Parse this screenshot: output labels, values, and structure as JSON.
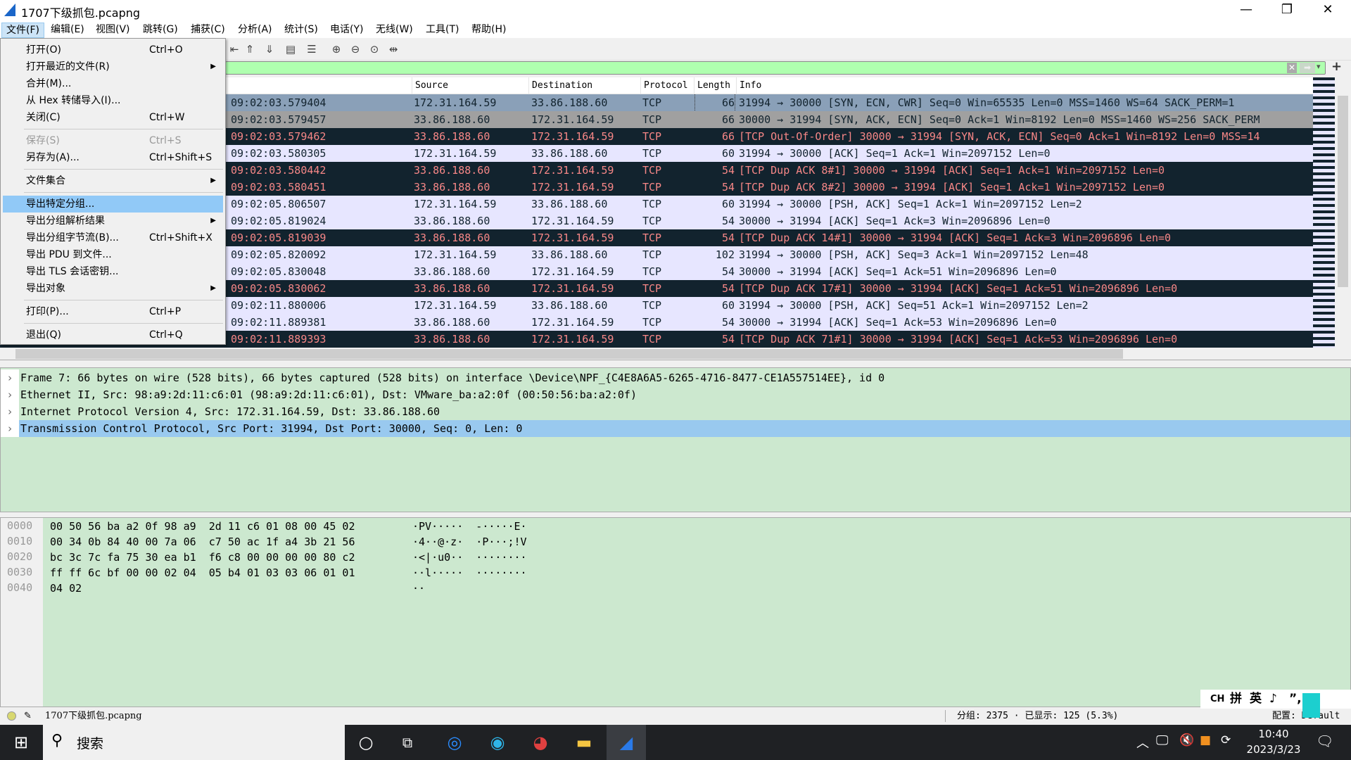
{
  "window": {
    "title": "1707下级抓包.pcapng",
    "minimize": "—",
    "restore": "❐",
    "close": "✕"
  },
  "menubar": [
    "文件(F)",
    "编辑(E)",
    "视图(V)",
    "跳转(G)",
    "捕获(C)",
    "分析(A)",
    "统计(S)",
    "电话(Y)",
    "无线(W)",
    "工具(T)",
    "帮助(H)"
  ],
  "file_menu": [
    {
      "label": "打开(O)",
      "shortcut": "Ctrl+O"
    },
    {
      "label": "打开最近的文件(R)",
      "submenu": true
    },
    {
      "label": "合并(M)..."
    },
    {
      "label": "从 Hex 转储导入(I)..."
    },
    {
      "label": "关闭(C)",
      "shortcut": "Ctrl+W"
    },
    {
      "sep": true
    },
    {
      "label": "保存(S)",
      "shortcut": "Ctrl+S",
      "disabled": true
    },
    {
      "label": "另存为(A)...",
      "shortcut": "Ctrl+Shift+S"
    },
    {
      "sep": true
    },
    {
      "label": "文件集合",
      "submenu": true
    },
    {
      "sep": true
    },
    {
      "label": "导出特定分组...",
      "highlighted": true
    },
    {
      "label": "导出分组解析结果",
      "submenu": true
    },
    {
      "label": "导出分组字节流(B)...",
      "shortcut": "Ctrl+Shift+X"
    },
    {
      "label": "导出 PDU 到文件..."
    },
    {
      "label": "导出 TLS 会话密钥..."
    },
    {
      "label": "导出对象",
      "submenu": true
    },
    {
      "sep": true
    },
    {
      "label": "打印(P)...",
      "shortcut": "Ctrl+P"
    },
    {
      "sep": true
    },
    {
      "label": "退出(Q)",
      "shortcut": "Ctrl+Q"
    }
  ],
  "toolbar_icons": [
    "go-first-icon",
    "go-top-icon",
    "go-bottom-icon",
    "autoscroll-icon",
    "colorize-icon",
    "zoom-in-icon",
    "zoom-out-icon",
    "zoom-normal-icon",
    "resize-columns-icon"
  ],
  "filter": {
    "value": "",
    "clear": "✕",
    "apply": "➡",
    "dropdown": "▾",
    "add": "+"
  },
  "columns": [
    "Source",
    "Destination",
    "Protocol",
    "Length",
    "Info"
  ],
  "packets": [
    {
      "time": "09:02:03.579404",
      "src": "172.31.164.59",
      "dst": "33.86.188.60",
      "proto": "TCP",
      "len": "66",
      "info": "31994 → 30000 [SYN, ECN, CWR] Seq=0 Win=65535 Len=0 MSS=1460 WS=64 SACK_PERM=1",
      "style": "sel"
    },
    {
      "time": "09:02:03.579457",
      "src": "33.86.188.60",
      "dst": "172.31.164.59",
      "proto": "TCP",
      "len": "66",
      "info": "30000 → 31994 [SYN, ACK, ECN] Seq=0 Ack=1 Win=8192 Len=0 MSS=1460 WS=256 SACK_PERM",
      "style": "gray"
    },
    {
      "time": "09:02:03.579462",
      "src": "33.86.188.60",
      "dst": "172.31.164.59",
      "proto": "TCP",
      "len": "66",
      "info": "[TCP Out-Of-Order] 30000 → 31994 [SYN, ACK, ECN] Seq=0 Ack=1 Win=8192 Len=0 MSS=14",
      "style": "dark"
    },
    {
      "time": "09:02:03.580305",
      "src": "172.31.164.59",
      "dst": "33.86.188.60",
      "proto": "TCP",
      "len": "60",
      "info": "31994 → 30000 [ACK] Seq=1 Ack=1 Win=2097152 Len=0",
      "style": "light"
    },
    {
      "time": "09:02:03.580442",
      "src": "33.86.188.60",
      "dst": "172.31.164.59",
      "proto": "TCP",
      "len": "54",
      "info": "[TCP Dup ACK 8#1] 30000 → 31994 [ACK] Seq=1 Ack=1 Win=2097152 Len=0",
      "style": "dark"
    },
    {
      "time": "09:02:03.580451",
      "src": "33.86.188.60",
      "dst": "172.31.164.59",
      "proto": "TCP",
      "len": "54",
      "info": "[TCP Dup ACK 8#2] 30000 → 31994 [ACK] Seq=1 Ack=1 Win=2097152 Len=0",
      "style": "dark"
    },
    {
      "time": "09:02:05.806507",
      "src": "172.31.164.59",
      "dst": "33.86.188.60",
      "proto": "TCP",
      "len": "60",
      "info": "31994 → 30000 [PSH, ACK] Seq=1 Ack=1 Win=2097152 Len=2",
      "style": "light"
    },
    {
      "time": "09:02:05.819024",
      "src": "33.86.188.60",
      "dst": "172.31.164.59",
      "proto": "TCP",
      "len": "54",
      "info": "30000 → 31994 [ACK] Seq=1 Ack=3 Win=2096896 Len=0",
      "style": "light"
    },
    {
      "time": "09:02:05.819039",
      "src": "33.86.188.60",
      "dst": "172.31.164.59",
      "proto": "TCP",
      "len": "54",
      "info": "[TCP Dup ACK 14#1] 30000 → 31994 [ACK] Seq=1 Ack=3 Win=2096896 Len=0",
      "style": "dark"
    },
    {
      "time": "09:02:05.820092",
      "src": "172.31.164.59",
      "dst": "33.86.188.60",
      "proto": "TCP",
      "len": "102",
      "info": "31994 → 30000 [PSH, ACK] Seq=3 Ack=1 Win=2097152 Len=48",
      "style": "light"
    },
    {
      "time": "09:02:05.830048",
      "src": "33.86.188.60",
      "dst": "172.31.164.59",
      "proto": "TCP",
      "len": "54",
      "info": "30000 → 31994 [ACK] Seq=1 Ack=51 Win=2096896 Len=0",
      "style": "light"
    },
    {
      "time": "09:02:05.830062",
      "src": "33.86.188.60",
      "dst": "172.31.164.59",
      "proto": "TCP",
      "len": "54",
      "info": "[TCP Dup ACK 17#1] 30000 → 31994 [ACK] Seq=1 Ack=51 Win=2096896 Len=0",
      "style": "dark"
    },
    {
      "time": "09:02:11.880006",
      "src": "172.31.164.59",
      "dst": "33.86.188.60",
      "proto": "TCP",
      "len": "60",
      "info": "31994 → 30000 [PSH, ACK] Seq=51 Ack=1 Win=2097152 Len=2",
      "style": "light"
    },
    {
      "time": "09:02:11.889381",
      "src": "33.86.188.60",
      "dst": "172.31.164.59",
      "proto": "TCP",
      "len": "54",
      "info": "30000 → 31994 [ACK] Seq=1 Ack=53 Win=2096896 Len=0",
      "style": "light"
    },
    {
      "time": "09:02:11.889393",
      "src": "33.86.188.60",
      "dst": "172.31.164.59",
      "proto": "TCP",
      "len": "54",
      "info": "[TCP Dup ACK 71#1] 30000 → 31994 [ACK] Seq=1 Ack=53 Win=2096896 Len=0",
      "style": "dark"
    }
  ],
  "details": [
    {
      "text": "Frame 7: 66 bytes on wire (528 bits), 66 bytes captured (528 bits) on interface \\Device\\NPF_{C4E8A6A5-6265-4716-8477-CE1A557514EE}, id 0"
    },
    {
      "text": "Ethernet II, Src: 98:a9:2d:11:c6:01 (98:a9:2d:11:c6:01), Dst: VMware_ba:a2:0f (00:50:56:ba:a2:0f)"
    },
    {
      "text": "Internet Protocol Version 4, Src: 172.31.164.59, Dst: 33.86.188.60"
    },
    {
      "text": "Transmission Control Protocol, Src Port: 31994, Dst Port: 30000, Seq: 0, Len: 0",
      "selected": true
    }
  ],
  "hex": [
    {
      "off": "0000",
      "bytes": "00 50 56 ba a2 0f 98 a9  2d 11 c6 01 08 00 45 02",
      "ascii": "·PV·····  -·····E·"
    },
    {
      "off": "0010",
      "bytes": "00 34 0b 84 40 00 7a 06  c7 50 ac 1f a4 3b 21 56",
      "ascii": "·4··@·z·  ·P···;!V"
    },
    {
      "off": "0020",
      "bytes": "bc 3c 7c fa 75 30 ea b1  f6 c8 00 00 00 00 80 c2",
      "ascii": "·<|·u0··  ········"
    },
    {
      "off": "0030",
      "bytes": "ff ff 6c bf 00 00 02 04  05 b4 01 03 03 06 01 01",
      "ascii": "··l·····  ········"
    },
    {
      "off": "0040",
      "bytes": "04 02",
      "ascii": "··"
    }
  ],
  "status": {
    "file": "1707下级抓包.pcapng",
    "packets": "分组: 2375 · 已显示: 125 (5.3%)",
    "profile": "配置: Default"
  },
  "ime": {
    "items": [
      "CH",
      "拼",
      "英",
      "♪",
      "”,",
      "⚙"
    ]
  },
  "taskbar": {
    "search": "搜索",
    "time": "10:40",
    "date": "2023/3/23"
  }
}
